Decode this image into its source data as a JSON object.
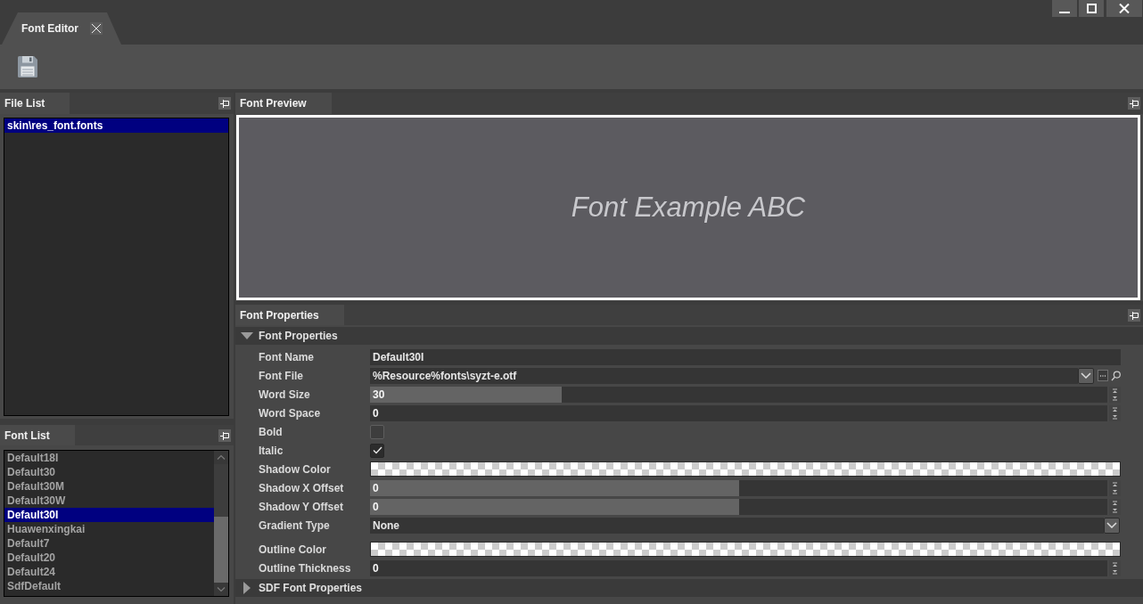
{
  "tabs": [
    {
      "label": "Font Editor",
      "selected": true
    }
  ],
  "file_list": {
    "title": "File List",
    "items": [
      {
        "label": "skin\\res_font.fonts",
        "selected": true
      }
    ]
  },
  "font_list": {
    "title": "Font List",
    "items": [
      {
        "label": "Default18I",
        "selected": false
      },
      {
        "label": "Default30",
        "selected": false
      },
      {
        "label": "Default30M",
        "selected": false
      },
      {
        "label": "Default30W",
        "selected": false
      },
      {
        "label": "Default30I",
        "selected": true
      },
      {
        "label": "Huawenxingkai",
        "selected": false
      },
      {
        "label": "Default7",
        "selected": false
      },
      {
        "label": "Default20",
        "selected": false
      },
      {
        "label": "Default24",
        "selected": false
      },
      {
        "label": "SdfDefault",
        "selected": false
      }
    ]
  },
  "font_preview": {
    "title": "Font Preview",
    "sample_text": "Font Example ABC"
  },
  "font_properties": {
    "title": "Font Properties",
    "groups": [
      {
        "label": "Font Properties",
        "expanded": true,
        "properties": [
          {
            "kind": "text",
            "label": "Font Name",
            "value": "Default30I"
          },
          {
            "kind": "file",
            "label": "Font File",
            "value": "%Resource%fonts\\syzt-e.otf"
          },
          {
            "kind": "spin",
            "label": "Word Size",
            "value": "30",
            "level": 0.26
          },
          {
            "kind": "spin",
            "label": "Word Space",
            "value": "0"
          },
          {
            "kind": "checkbox",
            "label": "Bold",
            "checked": false
          },
          {
            "kind": "checkbox",
            "label": "Italic",
            "checked": true
          },
          {
            "kind": "color",
            "label": "Shadow Color"
          },
          {
            "kind": "spin",
            "label": "Shadow X Offset",
            "value": "0",
            "level": 0.5
          },
          {
            "kind": "spin",
            "label": "Shadow Y Offset",
            "value": "0",
            "level": 0.5
          },
          {
            "kind": "combo",
            "label": "Gradient Type",
            "value": "None"
          },
          {
            "kind": "color",
            "label": "Outline Color"
          },
          {
            "kind": "spin",
            "label": "Outline Thickness",
            "value": "0"
          }
        ]
      },
      {
        "label": "SDF Font Properties",
        "expanded": false
      }
    ]
  }
}
